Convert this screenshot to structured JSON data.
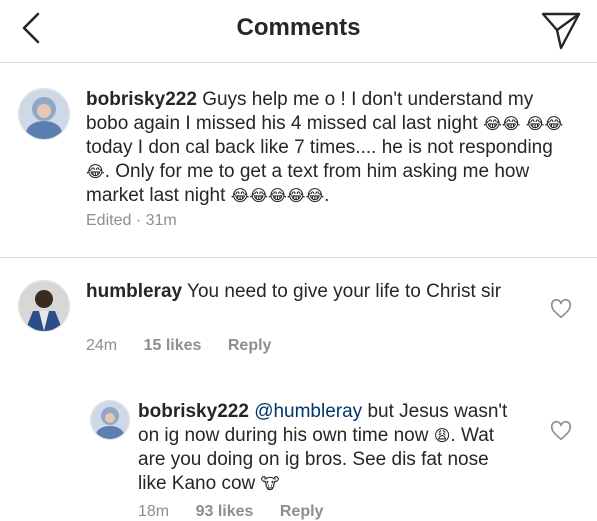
{
  "header": {
    "title": "Comments"
  },
  "caption": {
    "username": "bobrisky222",
    "text_1": "Guys help me o ! I don't understand my bobo again I missed his 4 missed cal last night",
    "emoji_a": "😂😂",
    "emoji_b": "😂😂",
    "text_2": "today I don cal back like 7 times.... he is not responding",
    "emoji_c": "😂",
    "text_3": ". Only for me to get a text from him asking me how market last night",
    "emoji_d": "😂😂😂😂😂",
    "text_4": ".",
    "meta": "Edited · 31m"
  },
  "comments": [
    {
      "username": "humbleray",
      "text": "You need to give your life to Christ sir",
      "time": "24m",
      "likes": "15 likes",
      "reply_label": "Reply"
    }
  ],
  "reply": {
    "username": "bobrisky222",
    "mention": "@humbleray",
    "text_1": "but Jesus wasn't on ig now  during his own time now",
    "emoji_a": "😩",
    "text_2": ". Wat are you doing on ig bros. See dis fat nose like Kano cow",
    "emoji_b": "🐮",
    "time": "18m",
    "likes": "93 likes",
    "reply_label": "Reply"
  },
  "colors": {
    "text": "#262626",
    "meta": "#8e8e8e",
    "mention": "#003569",
    "divider": "#dbdbdb",
    "emoji_yellow": "#f5c518"
  },
  "icons": [
    "chevron-left-icon",
    "direct-send-icon",
    "heart-outline-icon"
  ]
}
